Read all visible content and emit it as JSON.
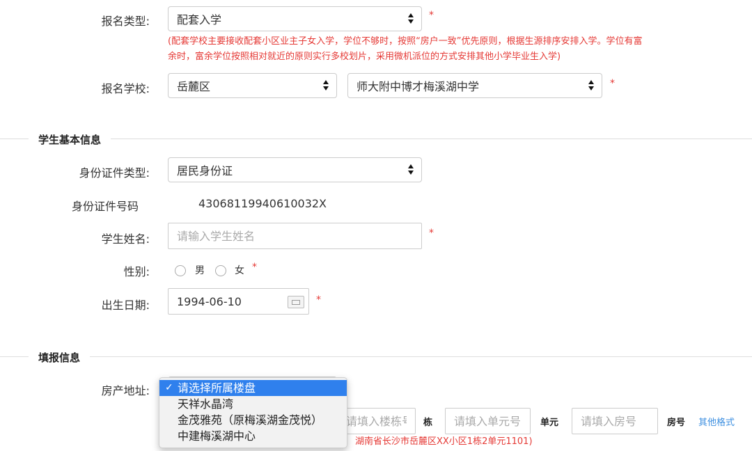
{
  "reg_type": {
    "label": "报名类型:",
    "value": "配套入学",
    "note_line1": "(配套学校主要接收配套小区业主子女入学，学位不够时，按照“房户一致”优先原则，根据生源排序安排入学。学位有富",
    "note_line2": "余时，富余学位按照相对就近的原则实行多校划片，采用微机派位的方式安排其他小学毕业生入学)"
  },
  "reg_school": {
    "label": "报名学校:",
    "district": "岳麓区",
    "school": "师大附中博才梅溪湖中学"
  },
  "student_section": {
    "title": "学生基本信息",
    "id_type_label": "身份证件类型:",
    "id_type_value": "居民身份证",
    "id_number_label": "身份证件号码",
    "id_number_value": "43068119940610032X",
    "name_label": "学生姓名:",
    "name_placeholder": "请输入学生姓名",
    "gender_label": "性别:",
    "gender_male": "男",
    "gender_female": "女",
    "birth_label": "出生日期:",
    "birth_value": "1994-06-10"
  },
  "fill_section": {
    "title": "填报信息",
    "address_label": "房产地址:",
    "dropdown_options": [
      "请选择所属楼盘",
      "天祥水晶湾",
      "金茂雅苑（原梅溪湖金茂悦）",
      "中建梅溪湖中心"
    ],
    "building_placeholder": "请填入楼栋号",
    "building_unit": "栋",
    "unit_placeholder": "请填入单元号",
    "unit_unit": "单元",
    "room_placeholder": "请填入房号",
    "room_unit": "房号",
    "other_format": "其他格式",
    "example": "湖南省长沙市岳麓区XX小区1栋2单元1101)"
  },
  "required_mark": "*",
  "checkmark": "✓"
}
